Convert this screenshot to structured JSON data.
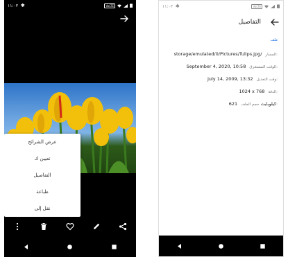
{
  "left": {
    "status": {
      "time": "١١:٠٣",
      "volte": "VoLTE"
    },
    "menu": {
      "items": [
        {
          "label": "عرض الشرائح"
        },
        {
          "label": "تعيين ك"
        },
        {
          "label": "التفاصيل"
        },
        {
          "label": "طباعة"
        },
        {
          "label": "نقل إلى"
        }
      ]
    },
    "actions": [
      "more-vert-icon",
      "delete-icon",
      "heart-icon",
      "edit-icon",
      "share-icon"
    ]
  },
  "right": {
    "status": {
      "time": "١١:٠٣",
      "volte": "VoLTE"
    },
    "title": "التفاصيل",
    "section": "ملف",
    "details": {
      "path_label": "المسار:",
      "path_value": "storage/emulated/0/Pictures/Tulips.jpg/",
      "taken_label": "الوقت المستغرق:",
      "taken_value": "September 4, 2020, 10:58",
      "modified_label": "وقت التعديل:",
      "modified_value": "July 14, 2009, 13:32",
      "size_label": "الدقة:",
      "size_value": "1024 x 768",
      "file_label": "حجم الملف:",
      "file_value": "621 كيلوبايت"
    }
  },
  "colors": {
    "accent": "#1a73e8",
    "dark_bg": "#000000",
    "menu_bg": "#ffffff"
  }
}
